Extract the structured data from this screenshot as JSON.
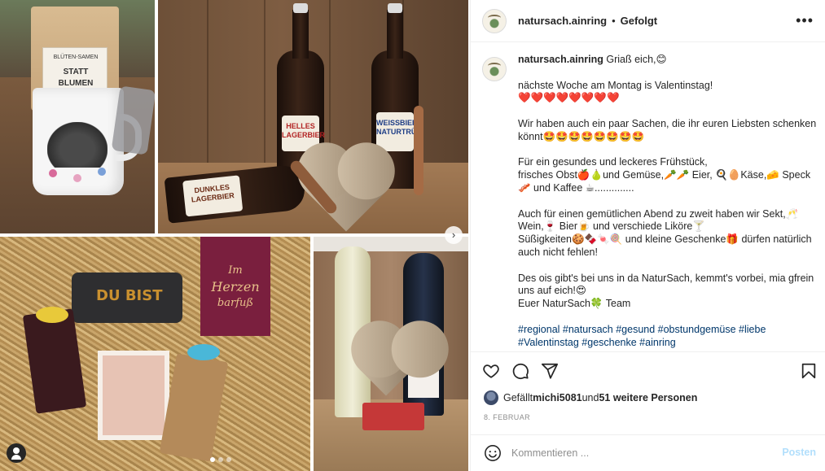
{
  "header": {
    "username": "natursach.ainring",
    "separator": "•",
    "follow_status": "Gefolgt",
    "more_label": "•••"
  },
  "caption": {
    "username": "natursach.ainring",
    "lines": [
      " Griaß eich,😊",
      "",
      "nächste Woche am Montag is Valentinstag!",
      "❤️❤️❤️❤️❤️❤️❤️❤️",
      "",
      "Wir haben auch ein paar Sachen, die ihr euren Liebsten schenken könnt🤩🤩🤩🤩🤩🤩🤩🤩",
      "",
      "Für ein gesundes und leckeres Frühstück,",
      "frisches Obst🍎🍐und Gemüse,🥕🥕 Eier, 🍳🥚Käse,🧀 Speck🥓 und Kaffee ☕..............",
      "",
      "Auch für einen gemütlichen Abend zu zweit haben wir Sekt,🥂 Wein,🍷 Bier🍺 und verschiede Liköre🍸",
      "Süßigkeiten🍪🍫🍬🍭 und kleine Geschenke🎁 dürfen natürlich auch nicht fehlen!",
      "",
      "Des ois gibt's bei uns in da NaturSach, kemmt's vorbei, mia gfrein uns auf eich!😍",
      "Euer NaturSach🍀 Team",
      "",
      "#regional #natursach #gesund #obstundgemüse #liebe #Valentinstag #geschenke #ainring"
    ]
  },
  "media": {
    "tile1_label_lines": [
      "BLÜTEN-SAMEN",
      "STATT",
      "BLUMEN"
    ],
    "tile2_bottle_labels": [
      "HELLES LAGERBIER",
      "WEISSBIER NATURTRÜB",
      "DUNKLES LAGERBIER"
    ],
    "tile3_pouch_text": "DU BIST",
    "tile3_bookmark_lines": [
      "Im",
      "Herzen",
      "barfuß"
    ],
    "next_arrow": "›"
  },
  "engagement": {
    "likes_prefix": "Gefällt ",
    "likes_user": "michi5081",
    "likes_mid": " und ",
    "likes_count": "51 weitere Personen",
    "date": "8. FEBRUAR"
  },
  "comment_box": {
    "placeholder": "Kommentieren ...",
    "post_label": "Posten"
  },
  "colors": {
    "accent": "#0095f6",
    "post_disabled": "#b2dffc",
    "hashtag": "#00376b"
  },
  "icons": {
    "like": "heart-icon",
    "comment": "comment-icon",
    "share": "send-icon",
    "save": "bookmark-icon",
    "emoji": "emoji-icon",
    "more": "more-icon"
  }
}
